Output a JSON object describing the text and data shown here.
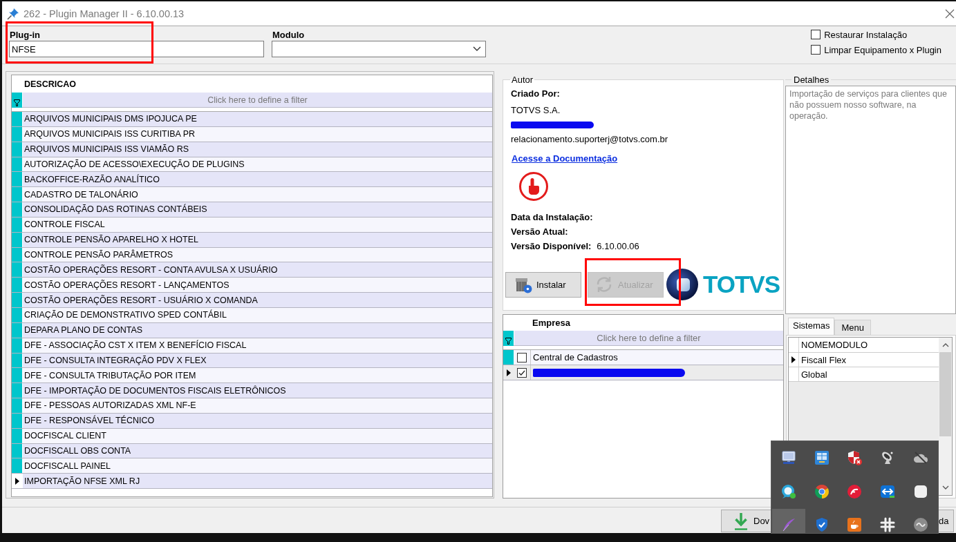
{
  "window": {
    "title": "262 - Plugin Manager II - 6.10.00.13"
  },
  "filters": {
    "plugin": {
      "label": "Plug-in",
      "value": "NFSE",
      "highlighted": true
    },
    "modulo": {
      "label": "Modulo"
    }
  },
  "options": [
    {
      "label": "Restaurar Instalação",
      "checked": false
    },
    {
      "label": "Limpar Equipamento x Plugin",
      "checked": false
    }
  ],
  "plugins": {
    "column": "DESCRICAO",
    "filter_hint": "Click here to define a filter",
    "rows": [
      {
        "text": "ARQUIVOS MUNICIPAIS DMS IPOJUCA PE",
        "selected": false
      },
      {
        "text": "ARQUIVOS MUNICIPAIS ISS CURITIBA PR",
        "selected": false
      },
      {
        "text": "ARQUIVOS MUNICIPAIS ISS VIAMÃO RS",
        "selected": false
      },
      {
        "text": "AUTORIZAÇÃO DE ACESSO\\EXECUÇÃO DE PLUGINS",
        "selected": false
      },
      {
        "text": "BACKOFFICE-RAZÃO ANALÍTICO",
        "selected": false
      },
      {
        "text": "CADASTRO DE TALONÁRIO",
        "selected": false
      },
      {
        "text": "CONSOLIDAÇÃO DAS ROTINAS CONTÁBEIS",
        "selected": false
      },
      {
        "text": "CONTROLE FISCAL",
        "selected": false
      },
      {
        "text": "CONTROLE PENSÃO APARELHO X HOTEL",
        "selected": false
      },
      {
        "text": "CONTROLE PENSÃO PARÂMETROS",
        "selected": false
      },
      {
        "text": "COSTÃO OPERAÇÕES RESORT - CONTA AVULSA X USUÁRIO",
        "selected": false
      },
      {
        "text": "COSTÃO OPERAÇÕES RESORT - LANÇAMENTOS",
        "selected": false
      },
      {
        "text": "COSTÃO OPERAÇÕES RESORT - USUÁRIO X COMANDA",
        "selected": false
      },
      {
        "text": "CRIAÇÃO DE DEMONSTRATIVO SPED CONTÁBIL",
        "selected": false
      },
      {
        "text": "DEPARA PLANO DE CONTAS",
        "selected": false
      },
      {
        "text": "DFE - ASSOCIAÇÃO CST X ITEM X BENEFÍCIO FISCAL",
        "selected": false
      },
      {
        "text": "DFE - CONSULTA INTEGRAÇÃO PDV X FLEX",
        "selected": false
      },
      {
        "text": "DFE - CONSULTA TRIBUTAÇÃO POR ITEM",
        "selected": false
      },
      {
        "text": "DFE - IMPORTAÇÃO DE DOCUMENTOS FISCAIS ELETRÔNICOS",
        "selected": false
      },
      {
        "text": "DFE - PESSOAS AUTORIZADAS XML NF-E",
        "selected": false
      },
      {
        "text": "DFE - RESPONSÁVEL TÉCNICO",
        "selected": false
      },
      {
        "text": "DOCFISCAL CLIENT",
        "selected": false
      },
      {
        "text": "DOCFISCALL OBS CONTA",
        "selected": false
      },
      {
        "text": "DOCFISCALL PAINEL",
        "selected": false
      },
      {
        "text": "IMPORTAÇÃO NFSE XML RJ",
        "selected": true
      }
    ]
  },
  "author": {
    "title": "Autor",
    "created_by_label": "Criado Por:",
    "lines": [
      {
        "kind": "text",
        "text": "TOTVS S.A."
      },
      {
        "kind": "redacted"
      },
      {
        "kind": "text",
        "text": "relacionamento.suporterj@totvs.com.br"
      }
    ],
    "doc_link": "Acesse a Documentação",
    "fields": [
      {
        "label": "Data da Instalação:"
      },
      {
        "label": "Versão Atual:"
      },
      {
        "label": "Versão Disponível:",
        "value": "6.10.00.06"
      }
    ],
    "buttons": [
      {
        "kind": "install",
        "label": "Instalar",
        "disabled": false,
        "highlighted": false
      },
      {
        "kind": "update",
        "label": "Atualizar",
        "disabled": true,
        "highlighted": true
      }
    ],
    "logo": {
      "text": "TOTVS"
    }
  },
  "details": {
    "title": "Detalhes",
    "text": "Importação de serviços para clientes que não possuem nosso software, na operação."
  },
  "companies": {
    "column": "Empresa",
    "filter_hint": "Click here to define a filter",
    "rows": [
      {
        "kind": "text",
        "name": "Central de Cadastros",
        "checked": false,
        "selected": false
      },
      {
        "kind": "redacted",
        "checked": true,
        "selected": true
      }
    ]
  },
  "side_tabs": [
    {
      "label": "Sistemas",
      "selected": true
    },
    {
      "label": "Menu",
      "selected": false
    }
  ],
  "systems": {
    "column": "NOMEMODULO",
    "rows": [
      {
        "name": "Fiscall Flex",
        "selected": true
      },
      {
        "name": "Global",
        "selected": false
      }
    ]
  },
  "footer_buttons": [
    {
      "kind": "download",
      "label": "Dov"
    },
    {
      "kind": "plain",
      "label": "da"
    }
  ],
  "tray": {
    "icons": [
      {
        "kind": "monitor",
        "hovered": false
      },
      {
        "kind": "window",
        "hovered": false
      },
      {
        "kind": "shieldx",
        "hovered": false
      },
      {
        "kind": "dish",
        "hovered": false
      },
      {
        "kind": "cloudoff",
        "hovered": false
      },
      {
        "kind": "chat",
        "hovered": false
      },
      {
        "kind": "ring",
        "hovered": false
      },
      {
        "kind": "disc",
        "hovered": false
      },
      {
        "kind": "arrows",
        "hovered": false
      },
      {
        "kind": "square",
        "hovered": false
      },
      {
        "kind": "feather",
        "hovered": true
      },
      {
        "kind": "shieldcheck",
        "hovered": false
      },
      {
        "kind": "cup",
        "hovered": false
      },
      {
        "kind": "hash",
        "hovered": false
      },
      {
        "kind": "circle",
        "hovered": false
      }
    ]
  }
}
